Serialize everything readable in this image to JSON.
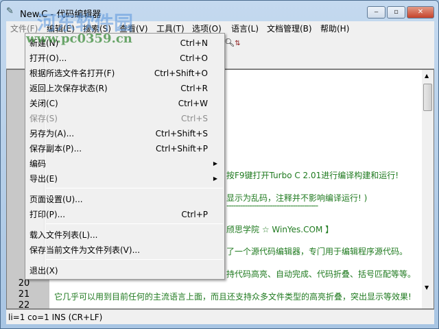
{
  "window": {
    "title": "New.C - 代码编辑器",
    "minimize": "‒",
    "maximize": "▫",
    "close": "✕"
  },
  "watermark": {
    "name": "河东软件园",
    "url": "www.pc0359.cn"
  },
  "menubar": [
    "文件(F)",
    "编辑(E)",
    "搜索(S)",
    "查看(V)",
    "工具(T)",
    "选项(O)",
    "语言(L)",
    "文档管理(B)",
    "帮助(H)"
  ],
  "file_menu": [
    {
      "label": "新建(N)",
      "shortcut": "Ctrl+N"
    },
    {
      "label": "打开(O)...",
      "shortcut": "Ctrl+O"
    },
    {
      "label": "根据所选文件名打开(F)",
      "shortcut": "Ctrl+Shift+O"
    },
    {
      "label": "返回上次保存状态(R)",
      "shortcut": "Ctrl+R"
    },
    {
      "label": "关闭(C)",
      "shortcut": "Ctrl+W"
    },
    {
      "label": "保存(S)",
      "shortcut": "Ctrl+S"
    },
    {
      "label": "另存为(A)...",
      "shortcut": "Ctrl+Shift+S"
    },
    {
      "label": "保存副本(P)...",
      "shortcut": "Ctrl+Shift+P"
    },
    {
      "label": "编码",
      "shortcut": ""
    },
    {
      "label": "导出(E)",
      "shortcut": ""
    },
    {
      "label": "页面设置(U)...",
      "shortcut": ""
    },
    {
      "label": "打印(P)...",
      "shortcut": "Ctrl+P"
    },
    {
      "label": "载入文件列表(L)...",
      "shortcut": ""
    },
    {
      "label": "保存当前文件为文件列表(V)...",
      "shortcut": ""
    },
    {
      "label": "退出(X)",
      "shortcut": ""
    }
  ],
  "editor": {
    "line_numbers": [
      "20",
      "21",
      "22"
    ],
    "lines": [
      "按F9键打开Turbo C 2.01进行编译构建和运行!",
      "显示为乱码，注释并不影响编译运行! )",
      "----------------------------------------",
      "颀思学院 ☆ WinYes.COM 】",
      "了一个源代码编辑器，专门用于编辑程序源代码。",
      "持代码高亮、自动完成、代码折叠、括号匹配等等。",
      "它几乎可以用到目前任何的主流语言上面，而且还支持众多文件类型的高亮折叠，突出显示等效果!"
    ]
  },
  "status": "li=1 co=1 INS (CR+LF)"
}
